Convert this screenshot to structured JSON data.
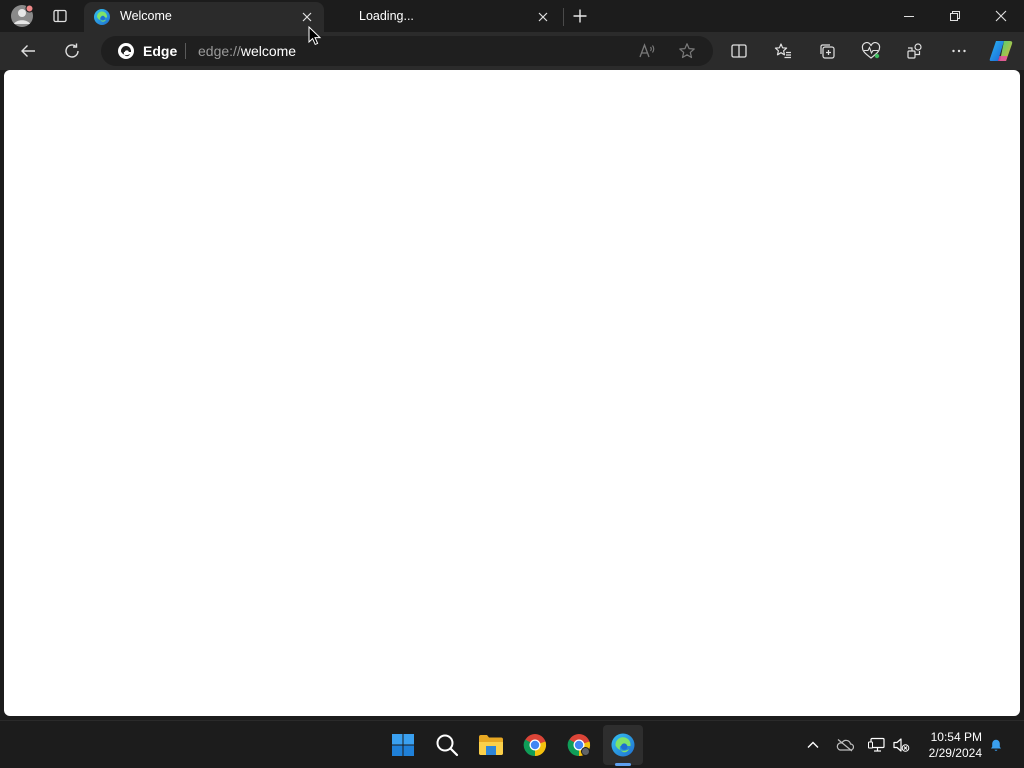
{
  "browser": {
    "tabs": [
      {
        "title": "Welcome",
        "active": true,
        "favicon": "edge-icon"
      },
      {
        "title": "Loading...",
        "active": false,
        "favicon": "none"
      }
    ],
    "window_controls": [
      "minimize-icon",
      "restore-icon",
      "close-icon"
    ]
  },
  "toolbar": {
    "address": {
      "site_label": "Edge",
      "url_scheme": "edge://",
      "url_host": "welcome"
    },
    "icons": [
      "back-icon",
      "refresh-icon",
      "read-aloud-icon",
      "favorite-star-icon",
      "split-screen-icon",
      "favorites-icon",
      "collections-icon",
      "browser-essentials-icon",
      "extensions-icon",
      "more-icon",
      "copilot-icon"
    ]
  },
  "taskbar": {
    "apps": [
      "start-icon",
      "search-icon",
      "file-explorer-icon",
      "chrome-icon",
      "chrome-icon",
      "edge-icon"
    ],
    "tray": [
      "chevron-up-icon",
      "onedrive-icon",
      "network-icon",
      "volume-muted-icon",
      "notification-bell-icon"
    ],
    "time": "10:54 PM",
    "date": "2/29/2024"
  },
  "colors": {
    "frame": "#1c1c1c",
    "toolbar": "#2b2b2b",
    "address_bar": "#1f1f1f",
    "accent": "#5ea0ef",
    "content": "#ffffff"
  }
}
